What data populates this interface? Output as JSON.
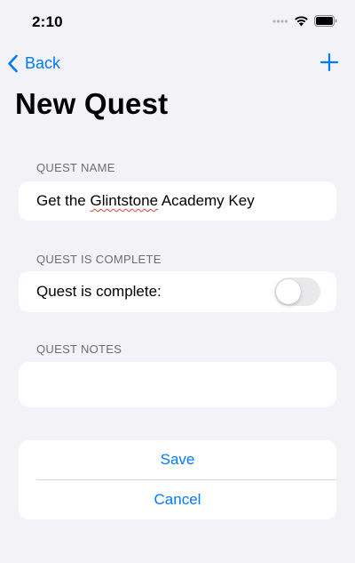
{
  "status_bar": {
    "time": "2:10",
    "icons": [
      "cellular-dots-icon",
      "wifi-icon",
      "battery-icon"
    ]
  },
  "nav": {
    "back_label": "Back",
    "back_icon": "chevron-left-icon",
    "add_icon": "plus-icon",
    "title": "New Quest"
  },
  "form": {
    "name_section": {
      "header": "QUEST NAME",
      "value_parts": [
        "Get the ",
        "Glintstone",
        " Academy Key"
      ]
    },
    "complete_section": {
      "header": "QUEST IS COMPLETE",
      "label": "Quest is complete:",
      "toggle_on": false
    },
    "notes_section": {
      "header": "QUEST NOTES",
      "value": ""
    },
    "actions": {
      "save_label": "Save",
      "cancel_label": "Cancel"
    }
  },
  "colors": {
    "accent": "#007aff",
    "background": "#f2f2f7",
    "card": "#ffffff",
    "section_header": "#6d6d72",
    "toggle_off": "#e9e9eb"
  }
}
